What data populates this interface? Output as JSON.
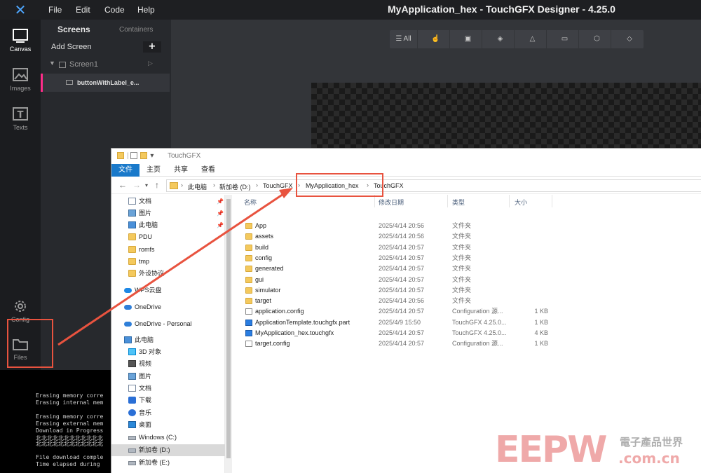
{
  "tgfx": {
    "title": "MyApplication_hex - TouchGFX Designer - 4.25.0",
    "menu": [
      "File",
      "Edit",
      "Code",
      "Help"
    ],
    "nav": {
      "canvas": "Canvas",
      "images": "Images",
      "texts": "Texts",
      "config": "Config",
      "files": "Files"
    },
    "screens_panel": {
      "screens_tab": "Screens",
      "containers_tab": "Containers",
      "add_screen": "Add Screen",
      "add_button": "+",
      "screen_name": "Screen1",
      "widget_name": "buttonWithLabel_e..."
    },
    "toolbar": {
      "all_label": "All"
    }
  },
  "console": {
    "lines": [
      "Erasing memory corre",
      "Erasing internal mem",
      "",
      "Erasing memory corre",
      "Erasing external mem",
      "Download in Progress",
      "北北北北北北北北北北北北",
      "北北北北北北北北北北北北",
      "",
      "File download comple",
      "Time elapsed during "
    ]
  },
  "explorer": {
    "window_title": "TouchGFX",
    "ribbon_tabs": [
      "文件",
      "主页",
      "共享",
      "查看"
    ],
    "breadcrumb": [
      "此电脑",
      "新加卷 (D:)",
      "TouchGFX",
      "MyApplication_hex",
      "TouchGFX"
    ],
    "nav_items": [
      {
        "label": "文档",
        "icon": "document-icon",
        "pinned": true
      },
      {
        "label": "图片",
        "icon": "pictures-icon",
        "pinned": true
      },
      {
        "label": "此电脑",
        "icon": "computer-icon",
        "pinned": true
      },
      {
        "label": "PDU",
        "icon": "folder-icon",
        "pinned": false
      },
      {
        "label": "romfs",
        "icon": "folder-icon",
        "pinned": false
      },
      {
        "label": "tmp",
        "icon": "folder-icon",
        "pinned": false
      },
      {
        "label": "外设协议",
        "icon": "folder-icon",
        "pinned": false
      },
      {
        "label": "WPS云盘",
        "icon": "wps-cloud-icon",
        "pinned": false
      },
      {
        "label": "OneDrive",
        "icon": "onedrive-icon",
        "pinned": false
      },
      {
        "label": "OneDrive - Personal",
        "icon": "onedrive-icon",
        "pinned": false
      },
      {
        "label": "此电脑",
        "icon": "computer-icon",
        "pinned": false
      },
      {
        "label": "3D 对象",
        "icon": "3d-objects-icon",
        "pinned": false
      },
      {
        "label": "视频",
        "icon": "video-icon",
        "pinned": false
      },
      {
        "label": "图片",
        "icon": "pictures-icon",
        "pinned": false
      },
      {
        "label": "文档",
        "icon": "document-icon",
        "pinned": false
      },
      {
        "label": "下载",
        "icon": "download-icon",
        "pinned": false
      },
      {
        "label": "音乐",
        "icon": "music-icon",
        "pinned": false
      },
      {
        "label": "桌面",
        "icon": "desktop-icon",
        "pinned": false
      },
      {
        "label": "Windows (C:)",
        "icon": "drive-icon",
        "pinned": false
      },
      {
        "label": "新加卷 (D:)",
        "icon": "drive-icon",
        "pinned": false,
        "selected": true
      },
      {
        "label": "新加卷 (E:)",
        "icon": "drive-icon",
        "pinned": false
      }
    ],
    "columns": {
      "name": "名称",
      "date": "修改日期",
      "type": "类型",
      "size": "大小"
    },
    "files": [
      {
        "name": "App",
        "date": "2025/4/14 20:56",
        "type": "文件夹",
        "size": "",
        "icon": "folder"
      },
      {
        "name": "assets",
        "date": "2025/4/14 20:56",
        "type": "文件夹",
        "size": "",
        "icon": "folder"
      },
      {
        "name": "build",
        "date": "2025/4/14 20:57",
        "type": "文件夹",
        "size": "",
        "icon": "folder"
      },
      {
        "name": "config",
        "date": "2025/4/14 20:57",
        "type": "文件夹",
        "size": "",
        "icon": "folder"
      },
      {
        "name": "generated",
        "date": "2025/4/14 20:57",
        "type": "文件夹",
        "size": "",
        "icon": "folder"
      },
      {
        "name": "gui",
        "date": "2025/4/14 20:57",
        "type": "文件夹",
        "size": "",
        "icon": "folder"
      },
      {
        "name": "simulator",
        "date": "2025/4/14 20:57",
        "type": "文件夹",
        "size": "",
        "icon": "folder"
      },
      {
        "name": "target",
        "date": "2025/4/14 20:56",
        "type": "文件夹",
        "size": "",
        "icon": "folder"
      },
      {
        "name": "application.config",
        "date": "2025/4/14 20:57",
        "type": "Configuration 源...",
        "size": "1 KB",
        "icon": "config"
      },
      {
        "name": "ApplicationTemplate.touchgfx.part",
        "date": "2025/4/9 15:50",
        "type": "TouchGFX 4.25.0...",
        "size": "1 KB",
        "icon": "tgfx"
      },
      {
        "name": "MyApplication_hex.touchgfx",
        "date": "2025/4/14 20:57",
        "type": "TouchGFX 4.25.0...",
        "size": "4 KB",
        "icon": "tgfx"
      },
      {
        "name": "target.config",
        "date": "2025/4/14 20:57",
        "type": "Configuration 源...",
        "size": "1 KB",
        "icon": "config"
      }
    ]
  },
  "watermark": {
    "big": "EEPW",
    "cn": "電子產品世界",
    "url": ".com.cn"
  },
  "colors": {
    "annotation": "#e8533f",
    "ribbon_file_tab": "#1979ca",
    "selection_accent": "#ff2d8a"
  }
}
